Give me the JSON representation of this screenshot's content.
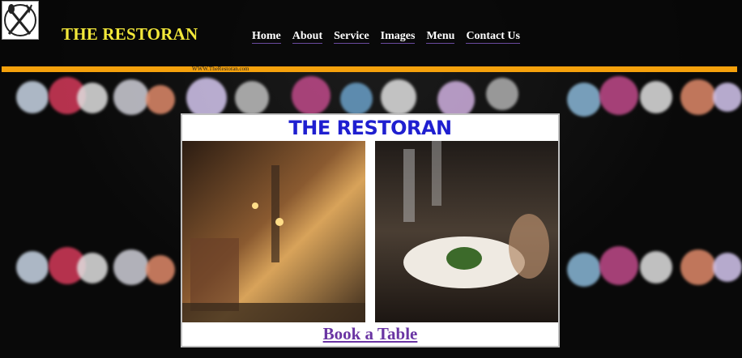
{
  "header": {
    "logo_icon": "cutlery-icon",
    "site_title": "THE RESTORAN",
    "www_text": "WWW.TheRestoran.com"
  },
  "nav": {
    "items": [
      {
        "label": "Home"
      },
      {
        "label": "About"
      },
      {
        "label": "Service"
      },
      {
        "label": "Images"
      },
      {
        "label": "Menu"
      },
      {
        "label": "Contact Us"
      }
    ]
  },
  "card": {
    "title": "THE RESTORAN",
    "left_photo": "restaurant-interior-photo",
    "right_photo": "plated-dish-photo",
    "book_label": "Book a Table"
  },
  "colors": {
    "title_yellow": "#f3e83a",
    "accent_orange": "#f5a10c",
    "card_title_blue": "#1f1fd0",
    "link_purple": "#6a35a3"
  }
}
